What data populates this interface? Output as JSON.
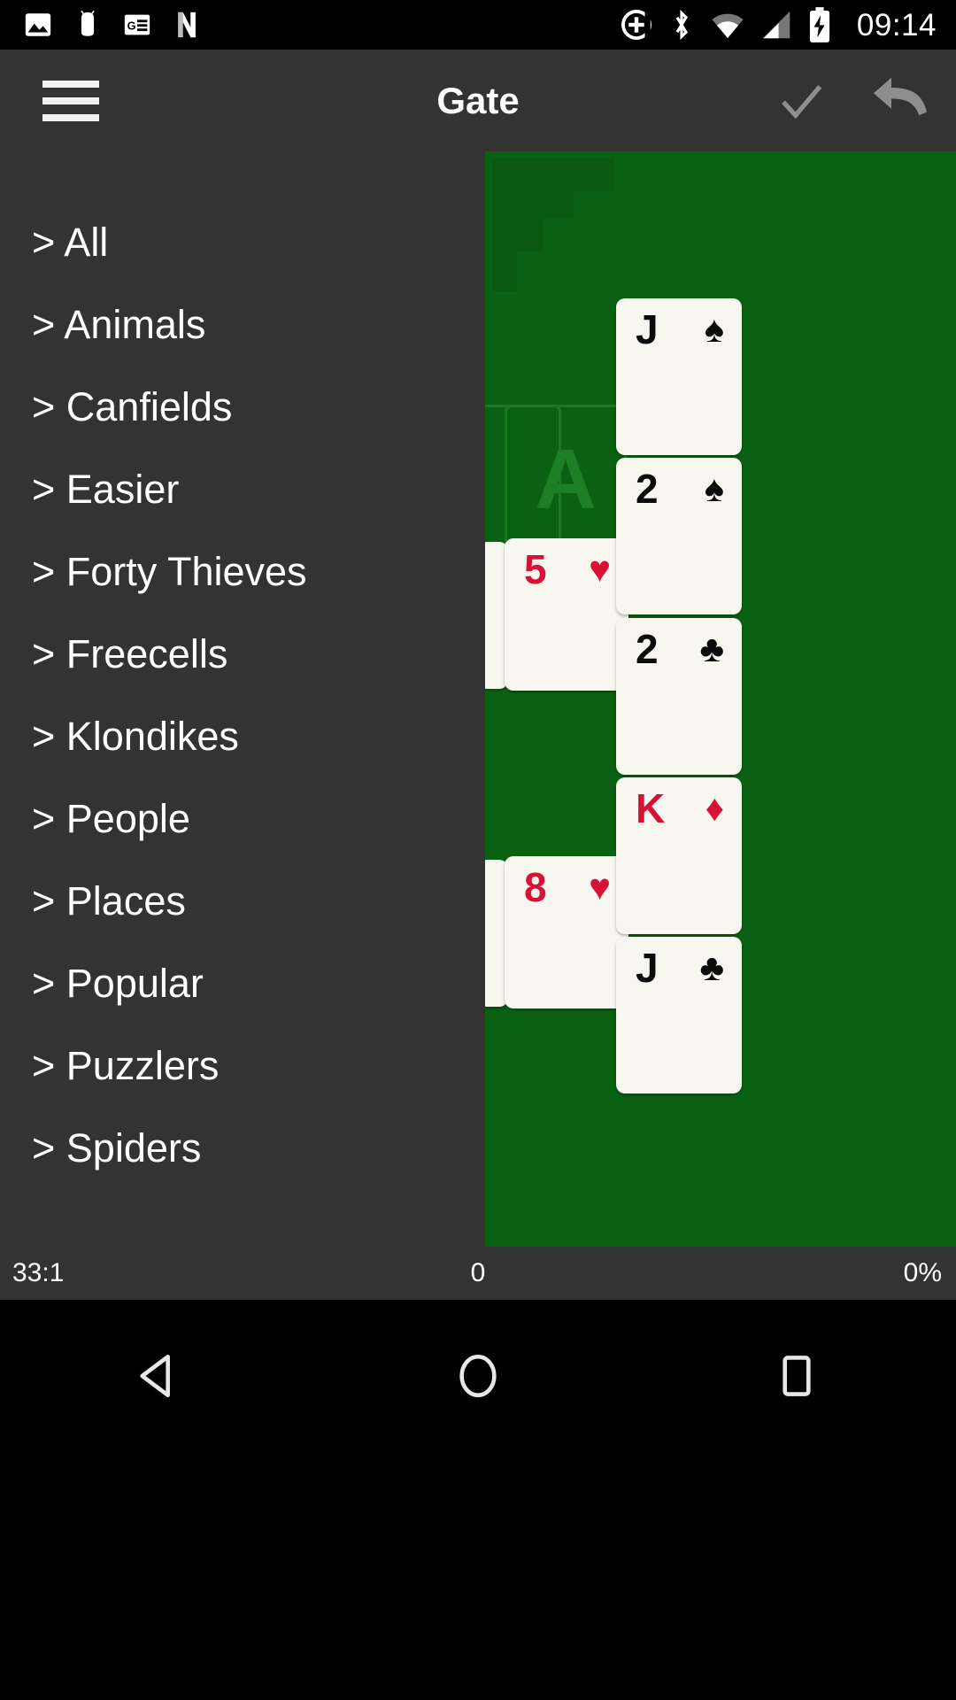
{
  "status_bar": {
    "left_icons": [
      {
        "name": "photo-icon"
      },
      {
        "name": "android-app-icon"
      },
      {
        "name": "google-news-icon"
      },
      {
        "name": "netflix-icon"
      }
    ],
    "right_icons": [
      {
        "name": "do-not-disturb-add-icon"
      },
      {
        "name": "bluetooth-icon"
      },
      {
        "name": "wifi-icon"
      },
      {
        "name": "cellular-signal-icon"
      },
      {
        "name": "battery-charging-icon"
      }
    ],
    "clock": "09:14"
  },
  "toolbar": {
    "menu_icon": "hamburger-menu-icon",
    "title": "Gate",
    "actions": [
      {
        "name": "confirm-button",
        "icon": "check-icon"
      },
      {
        "name": "undo-button",
        "icon": "undo-arrow-icon"
      }
    ]
  },
  "drawer": {
    "items": [
      {
        "prefix": "> ",
        "label": "All"
      },
      {
        "prefix": "> ",
        "label": "Animals"
      },
      {
        "prefix": "> ",
        "label": "Canfields"
      },
      {
        "prefix": "> ",
        "label": "Easier"
      },
      {
        "prefix": "> ",
        "label": "Forty Thieves"
      },
      {
        "prefix": "> ",
        "label": "Freecells"
      },
      {
        "prefix": "> ",
        "label": "Klondikes"
      },
      {
        "prefix": "> ",
        "label": "People"
      },
      {
        "prefix": "> ",
        "label": "Places"
      },
      {
        "prefix": "> ",
        "label": "Popular"
      },
      {
        "prefix": "> ",
        "label": "Puzzlers"
      },
      {
        "prefix": "> ",
        "label": "Spiders"
      }
    ],
    "full_labels": [
      "> All",
      "> Animals",
      "> Canfields",
      "> Easier",
      "> Forty Thieves",
      "> Freecells",
      "> Klondikes",
      "> People",
      "> Places",
      "> Popular",
      "> Puzzlers",
      "> Spiders"
    ]
  },
  "game_board": {
    "felt_color": "#0b6113",
    "foundations": [
      {
        "label": "A",
        "name": "foundation-pile-left"
      },
      {
        "label": "A",
        "name": "foundation-pile-right"
      }
    ],
    "cards": [
      {
        "rank": "J",
        "suit": "♠",
        "suit_name": "spades",
        "color": "black",
        "column": "right"
      },
      {
        "rank": "2",
        "suit": "♠",
        "suit_name": "spades",
        "color": "black",
        "column": "right"
      },
      {
        "rank": "2",
        "suit": "♣",
        "suit_name": "clubs",
        "color": "black",
        "column": "right"
      },
      {
        "rank": "K",
        "suit": "♦",
        "suit_name": "diamonds",
        "color": "red",
        "column": "right"
      },
      {
        "rank": "J",
        "suit": "♣",
        "suit_name": "clubs",
        "color": "black",
        "column": "right"
      },
      {
        "rank": "5",
        "suit": "♥",
        "suit_name": "hearts",
        "color": "red",
        "column": "middle"
      },
      {
        "rank": "8",
        "suit": "♥",
        "suit_name": "hearts",
        "color": "red",
        "column": "middle"
      }
    ]
  },
  "game_status": {
    "time": "33:1",
    "score": "0",
    "percent": "0%"
  },
  "nav_bar": {
    "buttons": [
      {
        "name": "back-button",
        "icon": "triangle-left-icon"
      },
      {
        "name": "home-button",
        "icon": "circle-icon"
      },
      {
        "name": "recents-button",
        "icon": "square-icon"
      }
    ]
  }
}
